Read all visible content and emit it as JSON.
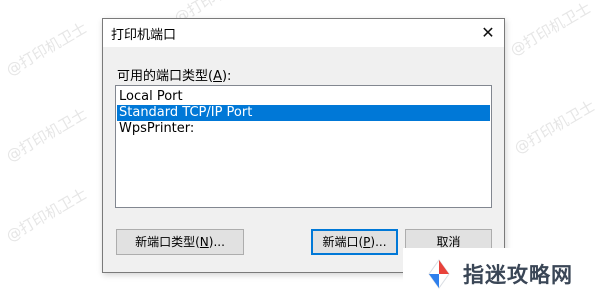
{
  "watermark": {
    "text": "@打印机卫士"
  },
  "dialog": {
    "title": "打印机端口",
    "close_glyph": "✕",
    "port_types_label_pre": "可用的端口类型(",
    "port_types_label_key": "A",
    "port_types_label_post": "):",
    "ports": [
      "Local Port",
      "Standard TCP/IP Port",
      "WpsPrinter:"
    ],
    "selected_index": 1,
    "buttons": {
      "new_port_type_pre": "新端口类型(",
      "new_port_type_key": "N",
      "new_port_type_post": ")...",
      "new_port_pre": "新端口(",
      "new_port_key": "P",
      "new_port_post": ")...",
      "cancel": "取消"
    }
  },
  "badge": {
    "text": "指迷攻略网"
  },
  "colors": {
    "selection": "#0078d7",
    "dialog_bg": "#f0f0f0",
    "badge_red": "#e8423b",
    "badge_blue": "#2f80ed"
  }
}
